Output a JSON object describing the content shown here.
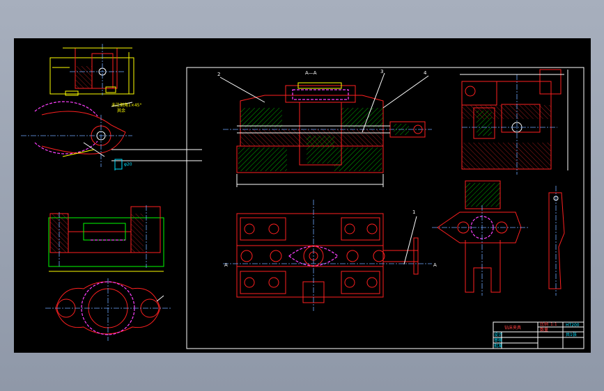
{
  "drawing": {
    "section_label": "A—A",
    "view_label_left": "A",
    "view_label_right": "A",
    "part_numbers": [
      "2",
      "3",
      "4",
      "1"
    ],
    "title_block": {
      "title": "钻床夹具",
      "scale_label": "比例",
      "scale_value": "1:1",
      "qty_label": "数量",
      "material": "HT200",
      "sheet": "共1张",
      "designer_label": "设计",
      "checker_label": "审核",
      "approver_label": "批准"
    },
    "left_notes": {
      "note_1": "未注倒角1×45°",
      "note_2": "其余",
      "dim_tag": "φ20"
    },
    "colors": {
      "background": "#000000",
      "outline": "#ff2020",
      "dimension": "#ffff00",
      "hatch": "#00ff00",
      "centerline": "#6fa8ff",
      "hidden": "#ff40ff",
      "frame": "#ffffff"
    }
  }
}
